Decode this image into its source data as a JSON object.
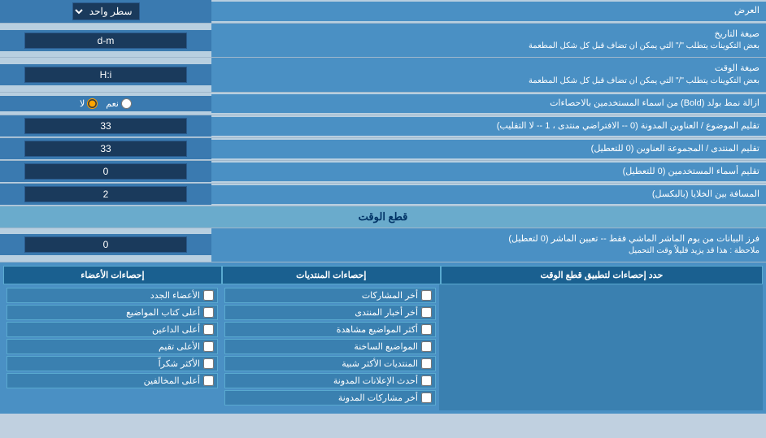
{
  "page": {
    "title": "العرض",
    "sections": {
      "display": {
        "rows": [
          {
            "label": "سطر واحد",
            "input_type": "select",
            "value": "سطر واحد"
          },
          {
            "label": "صيغة التاريخ",
            "sublabel": "بعض التكوينات يتطلب \"/\" التي يمكن ان تضاف قبل كل شكل المطعمة",
            "input_type": "text",
            "value": "d-m"
          },
          {
            "label": "صيغة الوقت",
            "sublabel": "بعض التكوينات يتطلب \"/\" التي يمكن ان تضاف قبل كل شكل المطعمة",
            "input_type": "text",
            "value": "H:i"
          },
          {
            "label": "ازالة نمط بولد (Bold) من اسماء المستخدمين بالاحصاءات",
            "input_type": "radio",
            "radio_yes": "نعم",
            "radio_no": "لا",
            "selected": "no"
          },
          {
            "label": "تقليم الموضوع / العناوين المدونة (0 -- الافتراضي منتدى ، 1 -- لا التقليب)",
            "input_type": "text",
            "value": "33"
          },
          {
            "label": "تقليم المنتدى / المجموعة العناوين (0 للتعطيل)",
            "input_type": "text",
            "value": "33"
          },
          {
            "label": "تقليم أسماء المستخدمين (0 للتعطيل)",
            "input_type": "text",
            "value": "0"
          },
          {
            "label": "المسافة بين الخلايا (بالبكسل)",
            "input_type": "text",
            "value": "2"
          }
        ]
      },
      "cutoff": {
        "header": "قطع الوقت",
        "rows": [
          {
            "label": "فرز البيانات من يوم الماشر الماشي فقط -- تعيين الماشر (0 لتعطيل)",
            "sublabel": "ملاحظة : هذا قد يزيد قليلاً وقت التحميل",
            "input_type": "text",
            "value": "0"
          }
        ],
        "time_limit_label": "حدد إحصاءات لتطبيق قطع الوقت"
      },
      "stats": {
        "col1_header": "إحصاءات المنتديات",
        "col2_header": "إحصاءات الأعضاء",
        "apply_header": "حدد إحصاءات لتطبيق قطع الوقت",
        "col1_items": [
          "أخر المشاركات",
          "أخر أخبار المنتدى",
          "أكثر المواضيع مشاهدة",
          "المواضيع الساخنة",
          "المنتديات الأكثر شبية",
          "أحدث الإعلانات المدونة",
          "أخر مشاركات المدونة"
        ],
        "col2_items": [
          "الأعضاء الجدد",
          "أعلى كتاب المواضيع",
          "أعلى الداعين",
          "الأعلى تقيم",
          "الأكثر شكراً",
          "أعلى المخالفين"
        ]
      }
    }
  }
}
